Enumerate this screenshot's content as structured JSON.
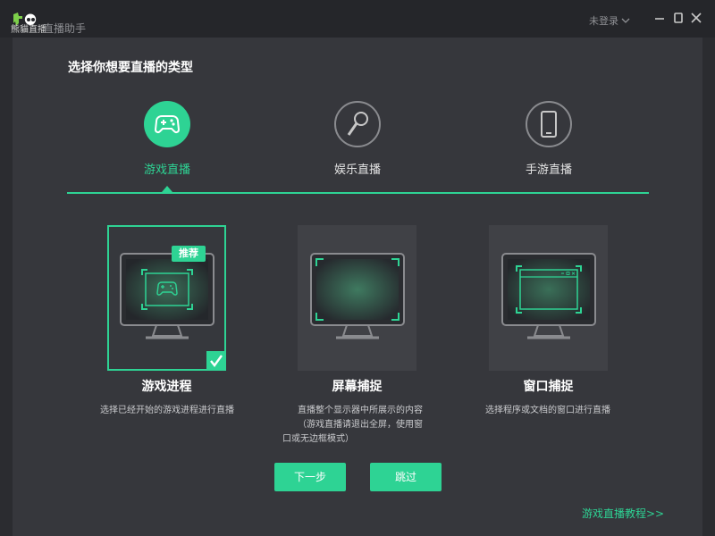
{
  "app": {
    "name": "直播助手",
    "logo_text": "熊貓直播",
    "login": "未登录"
  },
  "page": {
    "title": "选择你想要直播的类型"
  },
  "live_types": [
    {
      "label": "游戏直播",
      "icon": "gamepad-icon",
      "active": true
    },
    {
      "label": "娱乐直播",
      "icon": "microphone-icon",
      "active": false
    },
    {
      "label": "手游直播",
      "icon": "phone-icon",
      "active": false
    }
  ],
  "capture_modes": [
    {
      "title": "游戏进程",
      "desc": "选择已经开始的游戏进程进行直播",
      "badge": "推荐",
      "selected": true
    },
    {
      "title": "屏幕捕捉",
      "desc_lines": [
        "直播整个显示器中所展示的内容",
        "（游戏直播请退出全屏，使用窗",
        "口或无边框模式）"
      ],
      "selected": false
    },
    {
      "title": "窗口捕捉",
      "desc": "选择程序或文档的窗口进行直播",
      "selected": false
    }
  ],
  "buttons": {
    "next": "下一步",
    "skip": "跳过"
  },
  "tutorial_link": "游戏直播教程>>",
  "colors": {
    "accent": "#2ed394",
    "background": "#36373c",
    "titlebar": "#25262a"
  }
}
